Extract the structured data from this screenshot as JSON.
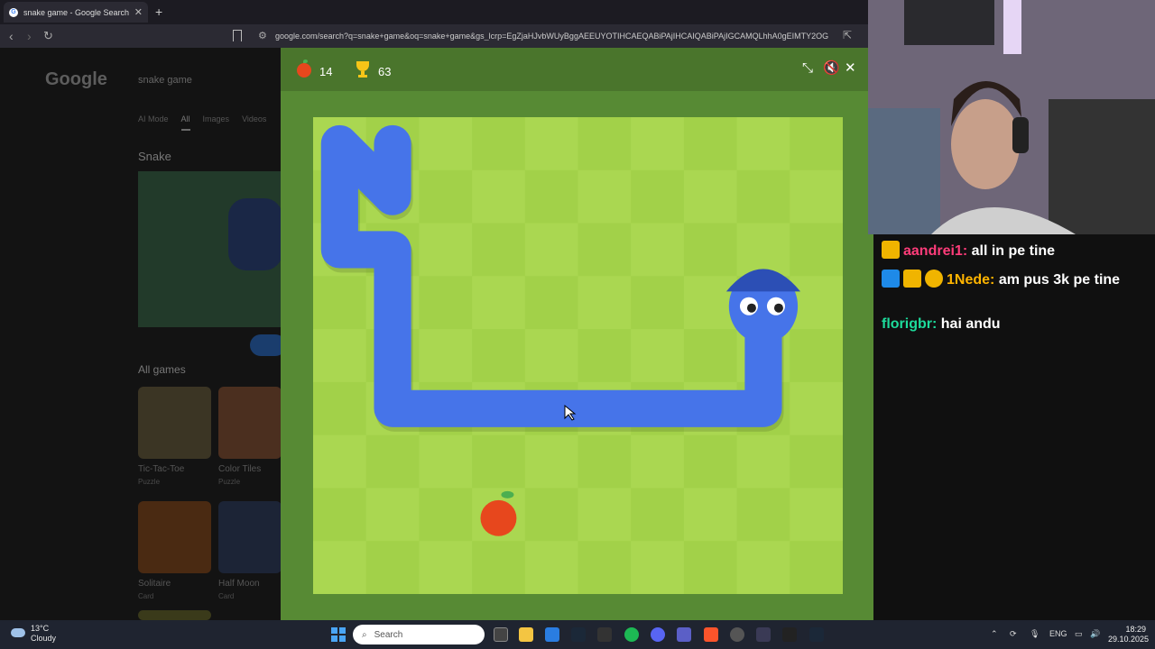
{
  "browser": {
    "tab_title": "snake game - Google Search",
    "url": "google.com/search?q=snake+game&oq=snake+game&gs_lcrp=EgZjaHJvbWUyBggAEEUYOTIHCAEQABiPAjIHCAIQABiPAjIGCAMQLhhA0gEIMTY2OG"
  },
  "google": {
    "logo": "Google",
    "query": "snake game",
    "tabs": [
      "AI Mode",
      "All",
      "Images",
      "Videos"
    ],
    "active_tab": "All",
    "section_title": "Snake",
    "all_games_title": "All games",
    "games": [
      {
        "name": "Tic-Tac-Toe",
        "category": "Puzzle"
      },
      {
        "name": "Color Tiles",
        "category": "Puzzle"
      },
      {
        "name": "Solitaire",
        "category": "Card"
      },
      {
        "name": "Half Moon",
        "category": "Card"
      }
    ]
  },
  "game": {
    "score": "14",
    "best": "63",
    "colors": {
      "header": "#4a752c",
      "frame": "#578a34",
      "light": "#aad751",
      "dark": "#a2d149",
      "snake": "#4674e9",
      "apple": "#e7471d"
    },
    "grid": {
      "cols": 10,
      "rows": 9
    },
    "snake_cells": [
      [
        1,
        0
      ],
      [
        1,
        1
      ],
      [
        0,
        0
      ],
      [
        0,
        1
      ],
      [
        0,
        2
      ],
      [
        1,
        2
      ],
      [
        1,
        3
      ],
      [
        1,
        4
      ],
      [
        1,
        5
      ],
      [
        2,
        5
      ],
      [
        3,
        5
      ],
      [
        4,
        5
      ],
      [
        5,
        5
      ],
      [
        6,
        5
      ],
      [
        7,
        5
      ],
      [
        8,
        5
      ],
      [
        8,
        4
      ],
      [
        8,
        3
      ]
    ],
    "apple_cell": [
      3,
      7
    ]
  },
  "chat": [
    {
      "user": "aandrei1:",
      "text": "all in pe tine",
      "color": "#ff3c7a"
    },
    {
      "user": "1Nede:",
      "text": "am pus 3k pe tine",
      "color": "#ffb400"
    },
    {
      "user": "florigbr:",
      "text": "hai andu",
      "color": "#1ddb9b"
    }
  ],
  "taskbar": {
    "temp": "13°C",
    "weather": "Cloudy",
    "search_placeholder": "Search",
    "lang": "ENG",
    "time": "18:29",
    "date": "29.10.2025"
  }
}
